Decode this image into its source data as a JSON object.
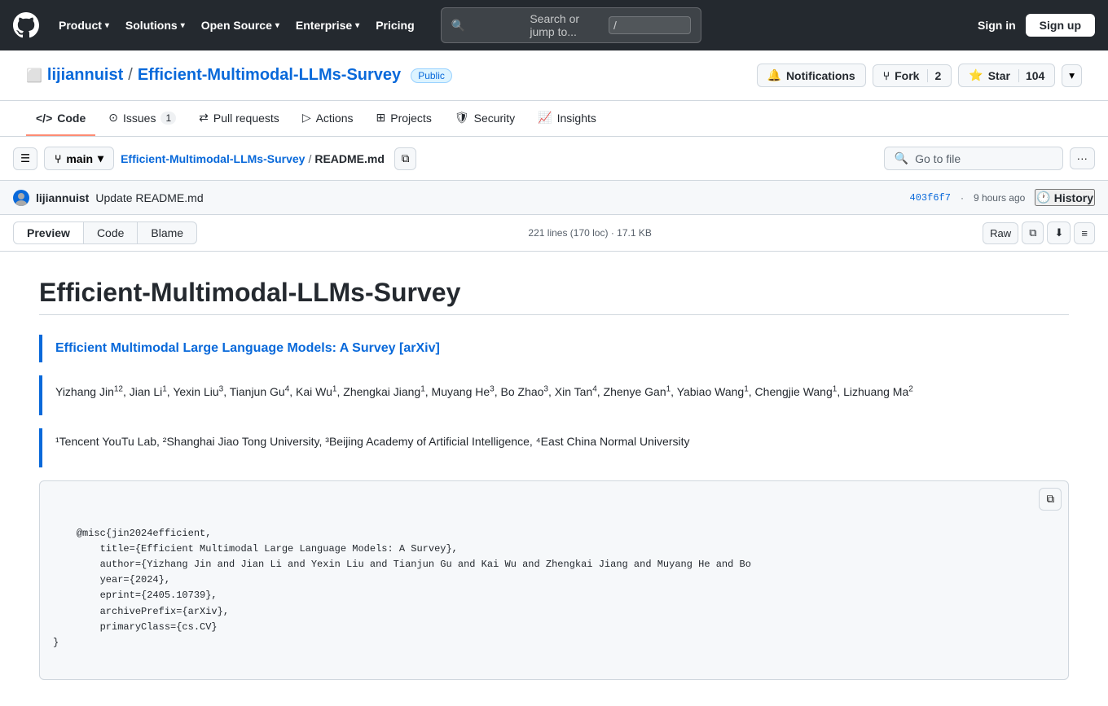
{
  "header": {
    "logo_label": "GitHub",
    "nav": [
      {
        "id": "product",
        "label": "Product",
        "has_dropdown": true
      },
      {
        "id": "solutions",
        "label": "Solutions",
        "has_dropdown": true
      },
      {
        "id": "open-source",
        "label": "Open Source",
        "has_dropdown": true
      },
      {
        "id": "enterprise",
        "label": "Enterprise",
        "has_dropdown": true
      },
      {
        "id": "pricing",
        "label": "Pricing",
        "has_dropdown": false
      }
    ],
    "search_placeholder": "Search or jump to...",
    "search_kbd": "/",
    "sign_in": "Sign in",
    "sign_up": "Sign up"
  },
  "repo": {
    "owner": "lijiannuist",
    "name": "Efficient-Multimodal-LLMs-Survey",
    "visibility": "Public",
    "notifications_label": "Notifications",
    "fork_label": "Fork",
    "fork_count": "2",
    "star_label": "Star",
    "star_count": "104"
  },
  "repo_nav": {
    "tabs": [
      {
        "id": "code",
        "label": "Code",
        "icon": "code",
        "badge": null,
        "active": true
      },
      {
        "id": "issues",
        "label": "Issues",
        "icon": "issues",
        "badge": "1",
        "active": false
      },
      {
        "id": "pull-requests",
        "label": "Pull requests",
        "icon": "pr",
        "badge": null,
        "active": false
      },
      {
        "id": "actions",
        "label": "Actions",
        "icon": "actions",
        "badge": null,
        "active": false
      },
      {
        "id": "projects",
        "label": "Projects",
        "icon": "projects",
        "badge": null,
        "active": false
      },
      {
        "id": "security",
        "label": "Security",
        "icon": "security",
        "badge": null,
        "active": false
      },
      {
        "id": "insights",
        "label": "Insights",
        "icon": "insights",
        "badge": null,
        "active": false
      }
    ]
  },
  "file_toolbar": {
    "branch": "main",
    "repo_link": "Efficient-Multimodal-LLMs-Survey",
    "path_sep": "/",
    "filename": "README.md",
    "go_to_file": "Go to file"
  },
  "commit": {
    "author_avatar_url": "",
    "author": "lijiannuist",
    "message": "Update README.md",
    "hash": "403f6f7",
    "time_ago": "9 hours ago",
    "history_label": "History"
  },
  "file_tabs": {
    "preview_label": "Preview",
    "code_label": "Code",
    "blame_label": "Blame",
    "stats": "221 lines (170 loc) · 17.1 KB",
    "raw_label": "Raw"
  },
  "readme": {
    "title": "Efficient-Multimodal-LLMs-Survey",
    "paper_link_text": "Efficient Multimodal Large Language Models: A Survey",
    "paper_link_suffix": " [arXiv]",
    "authors": "Yizhang Jin",
    "authors_sups": [
      {
        "name": "Yizhang Jin",
        "sup": "12"
      },
      {
        "name": "Jian Li",
        "sup": "1"
      },
      {
        "name": "Yexin Liu",
        "sup": "3"
      },
      {
        "name": "Tianjun Gu",
        "sup": "4"
      },
      {
        "name": "Kai Wu",
        "sup": "1"
      },
      {
        "name": "Zhengkai Jiang",
        "sup": "1"
      },
      {
        "name": "Muyang He",
        "sup": "3"
      },
      {
        "name": "Bo Zhao",
        "sup": "3"
      },
      {
        "name": "Xin Tan",
        "sup": "4"
      },
      {
        "name": "Zhenye Gan",
        "sup": "1"
      },
      {
        "name": "Yabiao Wang",
        "sup": "1"
      },
      {
        "name": "Chengjie Wang",
        "sup": "1"
      },
      {
        "name": "Lizhuang Ma",
        "sup": "2"
      }
    ],
    "affiliations": "¹Tencent YouTu Lab, ²Shanghai Jiao Tong University, ³Beijing Academy of Artificial Intelligence, ⁴East China Normal University",
    "bibtex": "@misc{jin2024efficient,\n        title={Efficient Multimodal Large Language Models: A Survey},\n        author={Yizhang Jin and Jian Li and Yexin Liu and Tianjun Gu and Kai Wu and Zhengkai Jiang and Muyang He and Bo\n        year={2024},\n        eprint={2405.10739},\n        archivePrefix={arXiv},\n        primaryClass={cs.CV}\n}"
  }
}
